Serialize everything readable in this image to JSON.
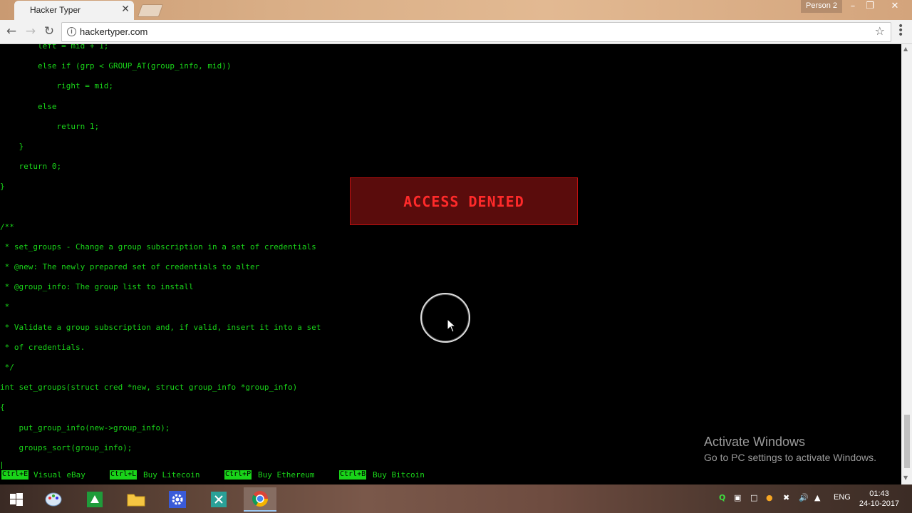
{
  "browser": {
    "tab_title": "Hacker Typer",
    "tab_close": "✕",
    "profile": "Person 2",
    "url": "hackertyper.com"
  },
  "code_lines": [
    "        left = mid + 1;",
    "        else if (grp < GROUP_AT(group_info, mid))",
    "            right = mid;",
    "        else",
    "            return 1;",
    "    }",
    "    return 0;",
    "}",
    "",
    "/**",
    " * set_groups - Change a group subscription in a set of credentials",
    " * @new: The newly prepared set of credentials to alter",
    " * @group_info: The group list to install",
    " *",
    " * Validate a group subscription and, if valid, insert it into a set",
    " * of credentials.",
    " */",
    "int set_groups(struct cred *new, struct group_info *group_info)",
    "{",
    "    put_group_info(new->group_info);",
    "    groups_sort(group_info);"
  ],
  "access_denied": "ACCESS DENIED",
  "shortcuts": [
    {
      "key": "Ctrl+E",
      "label": "Visual eBay"
    },
    {
      "key": "Ctrl+L",
      "label": "Buy Litecoin"
    },
    {
      "key": "Ctrl+P",
      "label": "Buy Ethereum"
    },
    {
      "key": "Ctrl+B",
      "label": "Buy Bitcoin"
    }
  ],
  "watermark": {
    "title": "Activate Windows",
    "subtitle": "Go to PC settings to activate Windows."
  },
  "taskbar": {
    "language": "ENG",
    "time": "01:43",
    "date": "24-10-2017"
  },
  "colors": {
    "code_green": "#19d419",
    "access_red": "#ff2a2a",
    "access_bg": "#5a0c0c"
  }
}
